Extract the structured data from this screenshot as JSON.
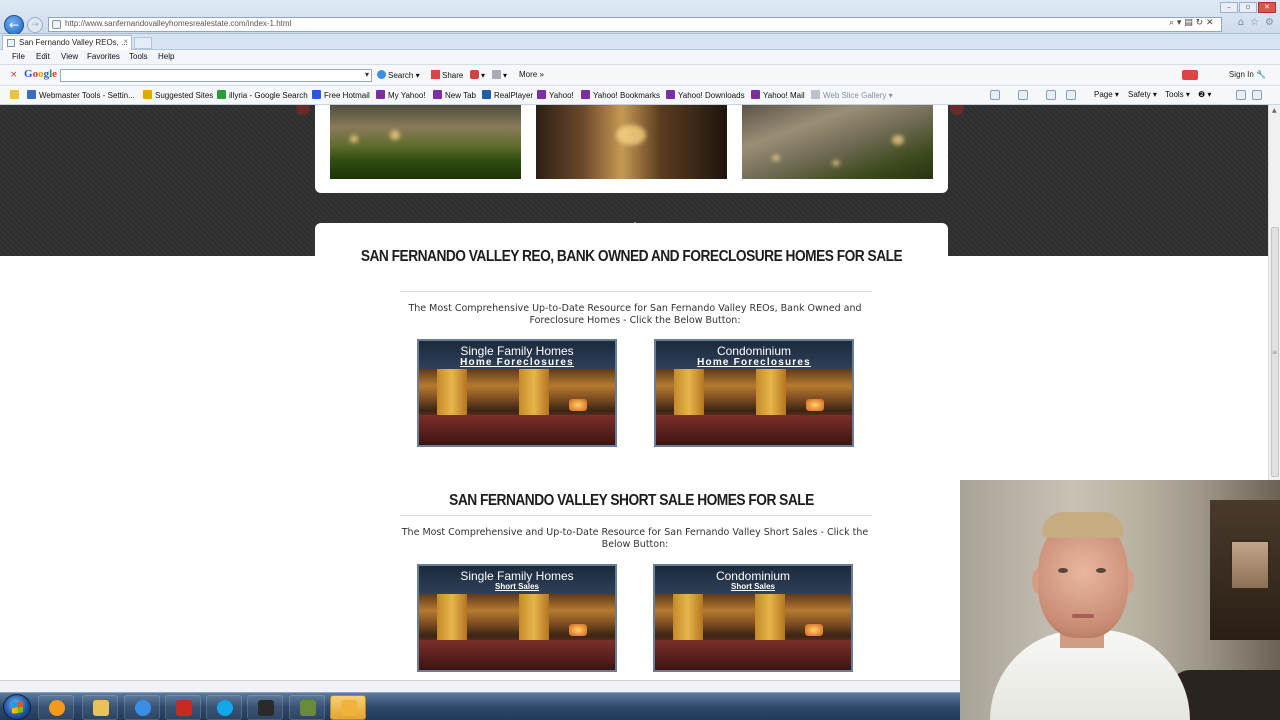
{
  "browser": {
    "url": "http://www.sanfernandovalleyhomesrealestate.com/index-1.html",
    "tab_title": "San Fernando Valley REOs, ...",
    "tab_close": "×",
    "address_controls": "⌕ ▾ ▤ ↻ ✕",
    "window_controls": [
      "–",
      "▫",
      "✕"
    ]
  },
  "menu": [
    "File",
    "Edit",
    "View",
    "Favorites",
    "Tools",
    "Help"
  ],
  "google_toolbar": {
    "close": "×",
    "logo": [
      "G",
      "o",
      "o",
      "g",
      "l",
      "e"
    ],
    "search_value": "",
    "search_label": "Search",
    "share_label": "Share",
    "more_label": "More »",
    "sign_in": "Sign In"
  },
  "favorites": [
    {
      "label": "Webmaster Tools - Settin...",
      "color": "#3b6fc2"
    },
    {
      "label": "Suggested Sites",
      "color": "#e7a500"
    },
    {
      "label": "illyria - Google Search",
      "color": "#2b9c3a"
    },
    {
      "label": "Free Hotmail",
      "color": "#2a5bd7"
    },
    {
      "label": "My Yahoo!",
      "color": "#7b2fa5"
    },
    {
      "label": "New Tab",
      "color": "#7b2fa5"
    },
    {
      "label": "RealPlayer",
      "color": "#1f5fa8"
    },
    {
      "label": "Yahoo!",
      "color": "#7b2fa5"
    },
    {
      "label": "Yahoo! Bookmarks",
      "color": "#7b2fa5"
    },
    {
      "label": "Yahoo! Downloads",
      "color": "#7b2fa5"
    },
    {
      "label": "Yahoo! Mail",
      "color": "#7b2fa5"
    },
    {
      "label": "Web Slice Gallery",
      "color": "#8090a5"
    }
  ],
  "command_bar": {
    "page": "Page ▾",
    "safety": "Safety ▾",
    "tools": "Tools ▾",
    "help": "❷ ▾"
  },
  "reo_section": {
    "title": "SAN FERNANDO VALLEY REO, BANK OWNED AND FORECLOSURE HOMES FOR SALE",
    "description": "The Most Comprehensive Up-to-Date Resource for San Fernando Valley REOs, Bank Owned and Foreclosure Homes - Click the Below Button:",
    "banners": [
      {
        "line1": "Single Family Homes",
        "line2": "Home Foreclosures"
      },
      {
        "line1": "Condominium",
        "line2": "Home Foreclosures"
      }
    ]
  },
  "short_sale_section": {
    "title": "SAN FERNANDO VALLEY SHORT SALE HOMES FOR SALE",
    "description": "The Most Comprehensive and Up-to-Date Resource for San Fernando Valley Short Sales - Click the Below Button:",
    "banners": [
      {
        "line1": "Single Family Homes",
        "line2": "Short Sales"
      },
      {
        "line1": "Condominium",
        "line2": "Short Sales"
      }
    ]
  },
  "taskbar_apps": [
    {
      "name": "media-player",
      "color": "#f39a1c"
    },
    {
      "name": "file-explorer",
      "color": "#e8c35a"
    },
    {
      "name": "internet-explorer",
      "color": "#3a8ee6"
    },
    {
      "name": "filezilla",
      "color": "#c62b22"
    },
    {
      "name": "skype",
      "color": "#12a7e8"
    },
    {
      "name": "camera-app",
      "color": "#2a2a2a"
    },
    {
      "name": "network-tool",
      "color": "#6b8a3a"
    },
    {
      "name": "outlook",
      "color": "#f0b23a"
    }
  ]
}
